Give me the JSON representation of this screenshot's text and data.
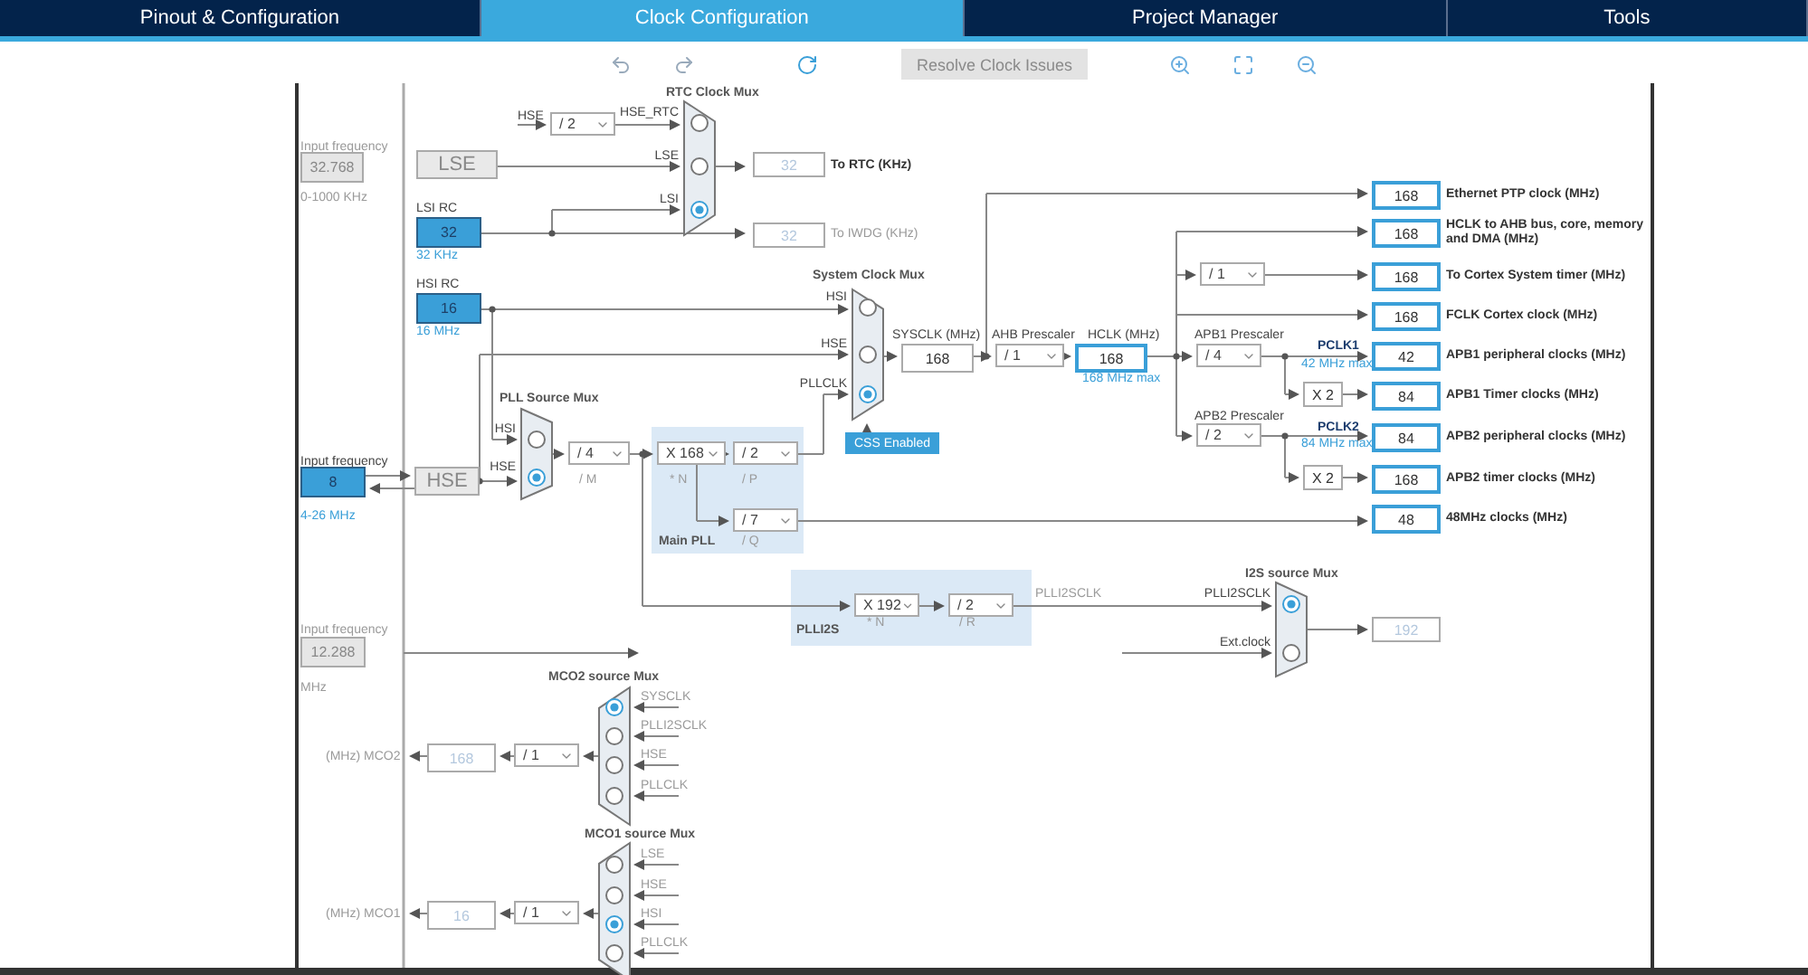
{
  "tabs": [
    {
      "label": "Pinout & Configuration",
      "selected": false
    },
    {
      "label": "Clock Configuration",
      "selected": true
    },
    {
      "label": "Project Manager",
      "selected": false
    },
    {
      "label": "Tools",
      "selected": false
    }
  ],
  "toolbar": {
    "resolve_button": "Resolve Clock Issues"
  },
  "diagram": {
    "labels": [
      {
        "text": "Input frequency",
        "kind": "muted"
      },
      {
        "text": "0-1000 KHz",
        "kind": "muted"
      },
      {
        "text": "LSI RC",
        "kind": "caption"
      },
      {
        "text": "32 KHz",
        "kind": "note"
      },
      {
        "text": "HSI RC",
        "kind": "caption"
      },
      {
        "text": "16 MHz",
        "kind": "note"
      },
      {
        "text": "Input frequency",
        "kind": "caption"
      },
      {
        "text": "4-26 MHz",
        "kind": "note"
      },
      {
        "text": "Input frequency",
        "kind": "muted"
      },
      {
        "text": "MHz",
        "kind": "muted"
      },
      {
        "text": "(MHz) MCO2",
        "kind": "muted"
      },
      {
        "text": "(MHz) MCO1",
        "kind": "muted"
      },
      {
        "text": "HSE",
        "kind": "caption"
      },
      {
        "text": "RTC Clock Mux",
        "kind": "title"
      },
      {
        "text": "To RTC (KHz)",
        "kind": "strong"
      },
      {
        "text": "To IWDG (KHz)",
        "kind": "muted"
      },
      {
        "text": "System Clock Mux",
        "kind": "title"
      },
      {
        "text": "SYSCLK (MHz)",
        "kind": "caption"
      },
      {
        "text": "AHB Prescaler",
        "kind": "caption"
      },
      {
        "text": "HCLK (MHz)",
        "kind": "caption"
      },
      {
        "text": "168 MHz max",
        "kind": "note"
      },
      {
        "text": "APB1 Prescaler",
        "kind": "caption"
      },
      {
        "text": "APB2 Prescaler",
        "kind": "caption"
      },
      {
        "text": "PCLK1",
        "kind": "wire"
      },
      {
        "text": "42 MHz max",
        "kind": "note"
      },
      {
        "text": "PCLK2",
        "kind": "wire"
      },
      {
        "text": "84 MHz max",
        "kind": "note"
      },
      {
        "text": "PLL Source Mux",
        "kind": "title"
      },
      {
        "text": "/ M",
        "kind": "muted"
      },
      {
        "text": "* N",
        "kind": "muted"
      },
      {
        "text": "/ P",
        "kind": "muted"
      },
      {
        "text": "Main PLL",
        "kind": "title"
      },
      {
        "text": "/ Q",
        "kind": "muted"
      },
      {
        "text": "* N",
        "kind": "muted"
      },
      {
        "text": "/ R",
        "kind": "muted"
      },
      {
        "text": "PLLI2S",
        "kind": "title"
      },
      {
        "text": "PLLI2SCLK",
        "kind": "muted"
      },
      {
        "text": "I2S source Mux",
        "kind": "title"
      },
      {
        "text": "MCO2 source Mux",
        "kind": "title"
      },
      {
        "text": "MCO1 source Mux",
        "kind": "title"
      }
    ],
    "value_boxes": [
      {
        "value": "32.768",
        "kind": "disabled"
      },
      {
        "value": "LSE",
        "kind": "source"
      },
      {
        "value": "32",
        "kind": "input"
      },
      {
        "value": "16",
        "kind": "input"
      },
      {
        "value": "8",
        "kind": "input"
      },
      {
        "value": "HSE",
        "kind": "source"
      },
      {
        "value": "12.288",
        "kind": "disabled"
      },
      {
        "value": "32",
        "kind": "faded"
      },
      {
        "value": "32",
        "kind": "faded"
      },
      {
        "value": "168",
        "kind": "plain"
      },
      {
        "value": "168",
        "kind": "highlight"
      },
      {
        "value": "X 2",
        "kind": "plain"
      },
      {
        "value": "X 2",
        "kind": "plain"
      },
      {
        "value": "192",
        "kind": "faded"
      },
      {
        "value": "168",
        "kind": "faded"
      },
      {
        "value": "16",
        "kind": "faded"
      }
    ],
    "dropdowns": [
      {
        "value": "/ 2"
      },
      {
        "value": "/ 1"
      },
      {
        "value": "/ 1"
      },
      {
        "value": "/ 4"
      },
      {
        "value": "/ 2"
      },
      {
        "value": "/ 4"
      },
      {
        "value": "X 168"
      },
      {
        "value": "/ 2"
      },
      {
        "value": "/ 7"
      },
      {
        "value": "X 192"
      },
      {
        "value": "/ 2"
      },
      {
        "value": "/ 1"
      },
      {
        "value": "/ 1"
      }
    ],
    "muxes": [
      {
        "inputs": [
          {
            "label": "HSE_RTC",
            "selected": false
          },
          {
            "label": "LSE",
            "selected": false
          },
          {
            "label": "LSI",
            "selected": true
          }
        ]
      },
      {
        "inputs": [
          {
            "label": "HSI",
            "selected": false
          },
          {
            "label": "HSE",
            "selected": false
          },
          {
            "label": "PLLCLK",
            "selected": true
          }
        ]
      },
      {
        "inputs": [
          {
            "label": "HSI",
            "selected": false
          },
          {
            "label": "HSE",
            "selected": true
          }
        ]
      },
      {
        "inputs": [
          {
            "label": "PLLI2SCLK",
            "selected": true
          },
          {
            "label": "Ext.clock",
            "selected": false
          }
        ]
      },
      {
        "inputs": [
          {
            "label": "SYSCLK",
            "selected": true
          },
          {
            "label": "PLLI2SCLK",
            "selected": false
          },
          {
            "label": "HSE",
            "selected": false
          },
          {
            "label": "PLLCLK",
            "selected": false
          }
        ]
      },
      {
        "inputs": [
          {
            "label": "LSE",
            "selected": false
          },
          {
            "label": "HSE",
            "selected": false
          },
          {
            "label": "HSI",
            "selected": true
          },
          {
            "label": "PLLCLK",
            "selected": false
          }
        ]
      }
    ],
    "css_button": "CSS Enabled",
    "outputs": [
      {
        "value": "168",
        "label": "Ethernet PTP clock (MHz)"
      },
      {
        "value": "168",
        "label": "HCLK to AHB bus, core, memory and DMA (MHz)"
      },
      {
        "value": "168",
        "label": "To Cortex System timer (MHz)"
      },
      {
        "value": "168",
        "label": "FCLK Cortex clock (MHz)"
      },
      {
        "value": "42",
        "label": "APB1 peripheral clocks (MHz)"
      },
      {
        "value": "84",
        "label": "APB1 Timer clocks (MHz)"
      },
      {
        "value": "84",
        "label": "APB2 peripheral clocks (MHz)"
      },
      {
        "value": "168",
        "label": "APB2 timer clocks (MHz)"
      },
      {
        "value": "48",
        "label": "48MHz clocks (MHz)"
      }
    ]
  }
}
